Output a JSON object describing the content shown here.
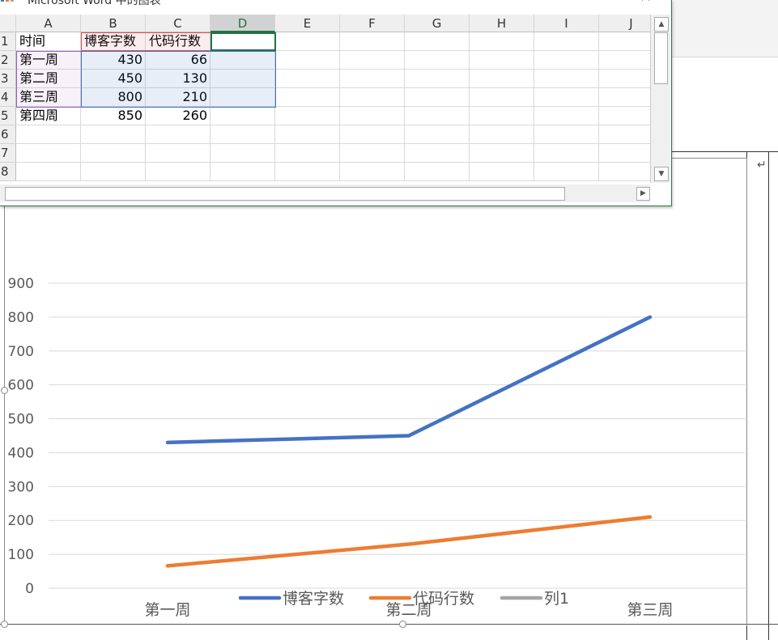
{
  "window": {
    "title": "Microsoft Word 中的图表",
    "close_glyph": "✕"
  },
  "sheet": {
    "columns": [
      "A",
      "B",
      "C",
      "D",
      "E",
      "F",
      "G",
      "H",
      "I",
      "J"
    ],
    "selected_column": "D",
    "rows": [
      "1",
      "2",
      "3",
      "4",
      "5",
      "6",
      "7",
      "8"
    ],
    "cells": [
      [
        "时间",
        "博客字数",
        "代码行数",
        ""
      ],
      [
        "第一周",
        "430",
        "66",
        ""
      ],
      [
        "第二周",
        "450",
        "130",
        ""
      ],
      [
        "第三周",
        "800",
        "210",
        ""
      ],
      [
        "第四周",
        "850",
        "260",
        ""
      ]
    ]
  },
  "scrollbars": {
    "up_glyph": "▲",
    "down_glyph": "▼",
    "right_glyph": "▶"
  },
  "document": {
    "return_glyph": "↵"
  },
  "colors": {
    "series1": "#4472c4",
    "series2": "#ed7d31",
    "series3": "#a5a5a5",
    "excel_green": "#217346"
  },
  "chart_data": {
    "type": "line",
    "categories": [
      "第一周",
      "第二周",
      "第三周"
    ],
    "series": [
      {
        "name": "博客字数",
        "values": [
          430,
          450,
          800
        ]
      },
      {
        "name": "代码行数",
        "values": [
          66,
          130,
          210
        ]
      },
      {
        "name": "列1",
        "values": []
      }
    ],
    "ylim": [
      0,
      900
    ],
    "yticks": [
      0,
      100,
      200,
      300,
      400,
      500,
      600,
      700,
      800,
      900
    ],
    "grid": true,
    "legend": "bottom"
  }
}
